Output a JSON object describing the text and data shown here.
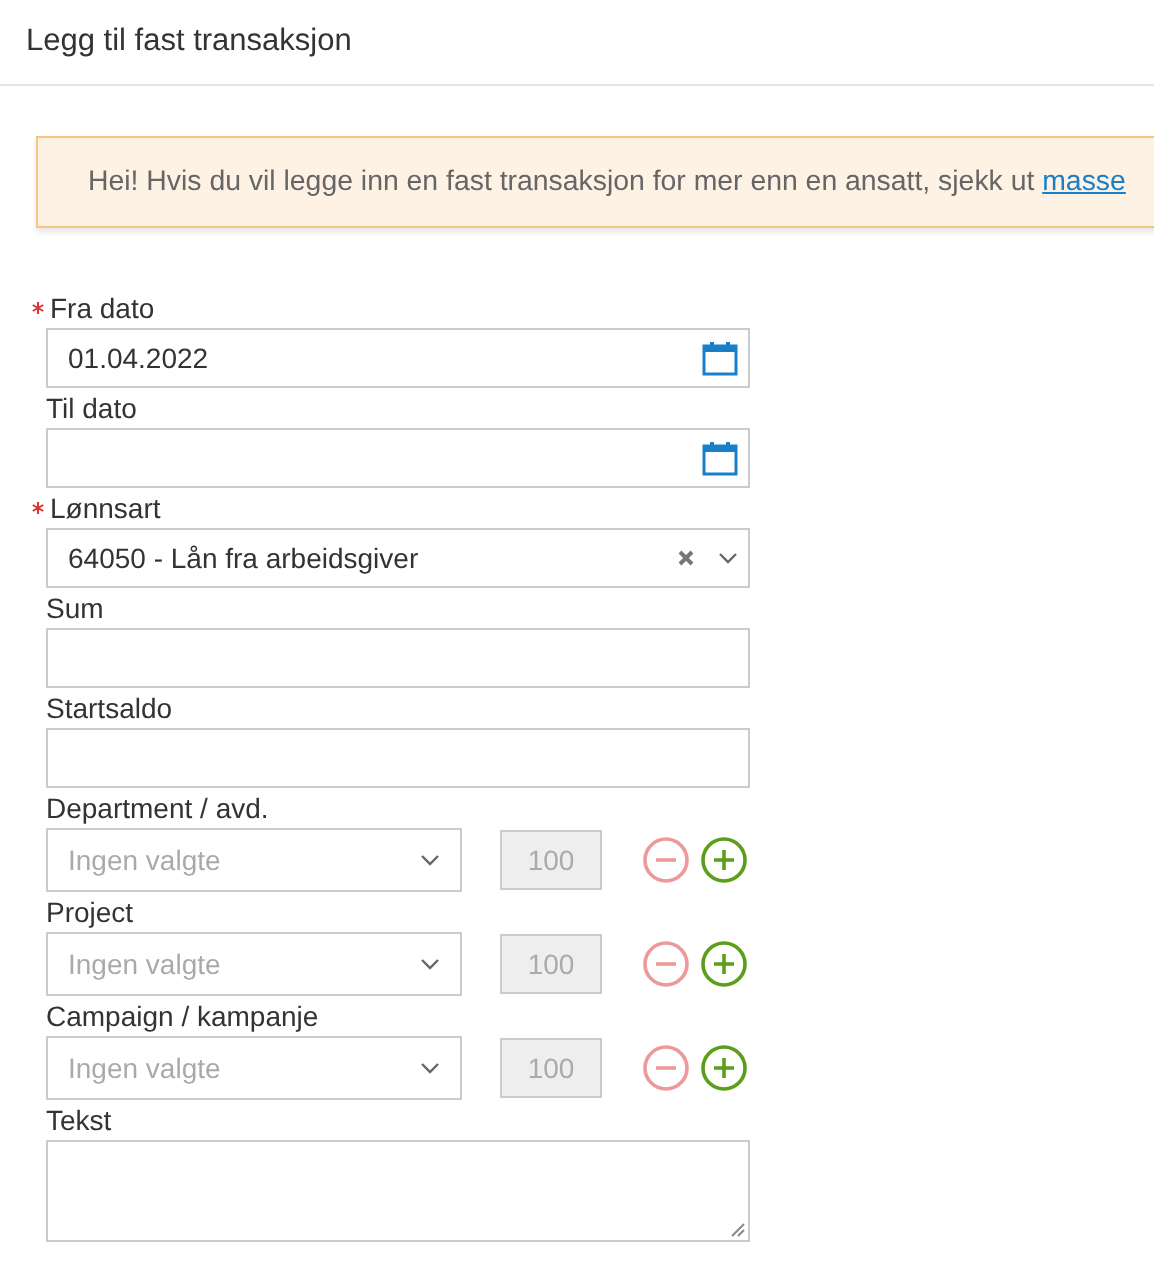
{
  "window": {
    "title": "Legg til fast transaksjon"
  },
  "notice": {
    "text": "Hei! Hvis du vil legge inn en fast transaksjon for mer enn en ansatt, sjekk ut",
    "link": "masse"
  },
  "fields": [
    {
      "kind": "date",
      "label": "Fra dato",
      "required": true,
      "value": "01.04.2022"
    },
    {
      "kind": "date",
      "label": "Til dato",
      "required": false
    },
    {
      "kind": "select",
      "label": "Lønnsart",
      "required": true,
      "value": "64050 - Lån fra arbeidsgiver"
    },
    {
      "kind": "text",
      "label": "Sum",
      "required": false
    },
    {
      "kind": "text",
      "label": "Startsaldo",
      "required": false
    },
    {
      "kind": "dimension",
      "label": "Department / avd.",
      "required": false,
      "placeholder": "Ingen valgte",
      "percent": "100"
    },
    {
      "kind": "dimension",
      "label": "Project",
      "required": false,
      "placeholder": "Ingen valgte",
      "percent": "100"
    },
    {
      "kind": "dimension",
      "label": "Campaign / kampanje",
      "required": false,
      "placeholder": "Ingen valgte",
      "percent": "100"
    },
    {
      "kind": "textarea",
      "label": "Tekst",
      "required": false
    }
  ]
}
